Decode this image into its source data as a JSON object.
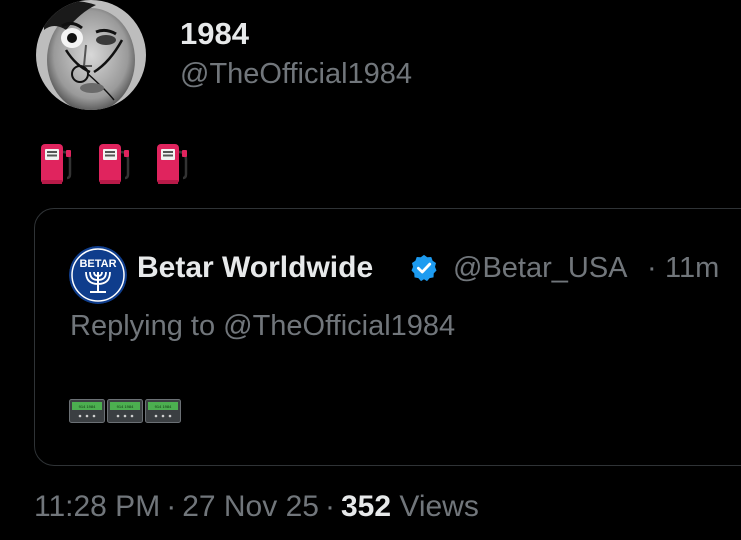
{
  "post": {
    "author_name": "1984",
    "author_handle": "@TheOfficial1984",
    "avatar_icon": "avatar-portrait-mustache",
    "emoji": [
      "fuel-pump-icon",
      "fuel-pump-icon",
      "fuel-pump-icon"
    ],
    "time": "11:28 PM",
    "date": "27 Nov 25",
    "views_count": "352",
    "views_label": "Views",
    "separator": "·"
  },
  "quote": {
    "author_name": "Betar Worldwide",
    "author_handle": "@Betar_USA",
    "separator": "·",
    "time": "11m",
    "reply_text": "Replying to @TheOfficial1984",
    "avatar_text": "BETAR",
    "pager_text": [
      "914 1984",
      "914 1984",
      "914 1984"
    ]
  },
  "colors": {
    "background": "#000000",
    "primary_text": "#e7e9ea",
    "secondary_text": "#71767b",
    "border": "#2f3336",
    "verified": "#1d9bf0"
  }
}
